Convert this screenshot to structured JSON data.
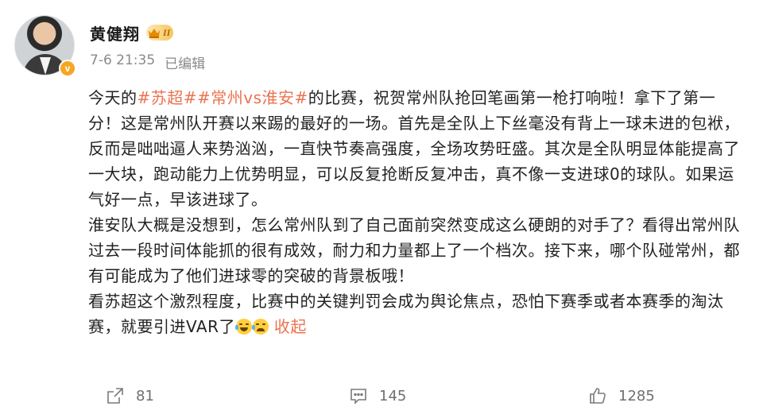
{
  "author": {
    "name": "黄健翔",
    "level_badge": "II",
    "verified_badge": "v"
  },
  "post_meta": {
    "time": "7-6 21:35",
    "edited": "已编辑"
  },
  "content": {
    "p1_prefix": "今天的",
    "tag1": "#苏超#",
    "tag2": "#常州vs淮安#",
    "p1_text": "的比赛，祝贺常州队抢回笔画第一枪打响啦！拿下了第一分！这是常州队开赛以来踢的最好的一场。首先是全队上下丝毫没有背上一球未进的包袱，反而是咄咄逼人来势汹汹，一直快节奏高强度，全场攻势旺盛。其次是全队明显体能提高了一大块，跑动能力上优势明显，可以反复抢断反复冲击，真不像一支进球0的球队。如果运气好一点，早该进球了。",
    "p2": "淮安队大概是没想到，怎么常州队到了自己面前突然变成这么硬朗的对手了？看得出常州队过去一段时间体能抓的很有成效，耐力和力量都上了一个档次。接下来，哪个队碰常州，都有可能成为了他们进球零的突破的背景板哦！",
    "p3": "看苏超这个激烈程度，比赛中的关键判罚会成为舆论焦点，恐怕下赛季或者本赛季的淘汰赛，就要引进VAR了",
    "emojis": [
      "laugh-cry-emoji",
      "cry-emoji"
    ],
    "collapse_label": "收起"
  },
  "actions": {
    "repost_count": "81",
    "comment_count": "145",
    "like_count": "1285"
  },
  "colors": {
    "accent": "#eb7350",
    "meta_text": "#8a8a8a",
    "body_text": "#222222"
  }
}
